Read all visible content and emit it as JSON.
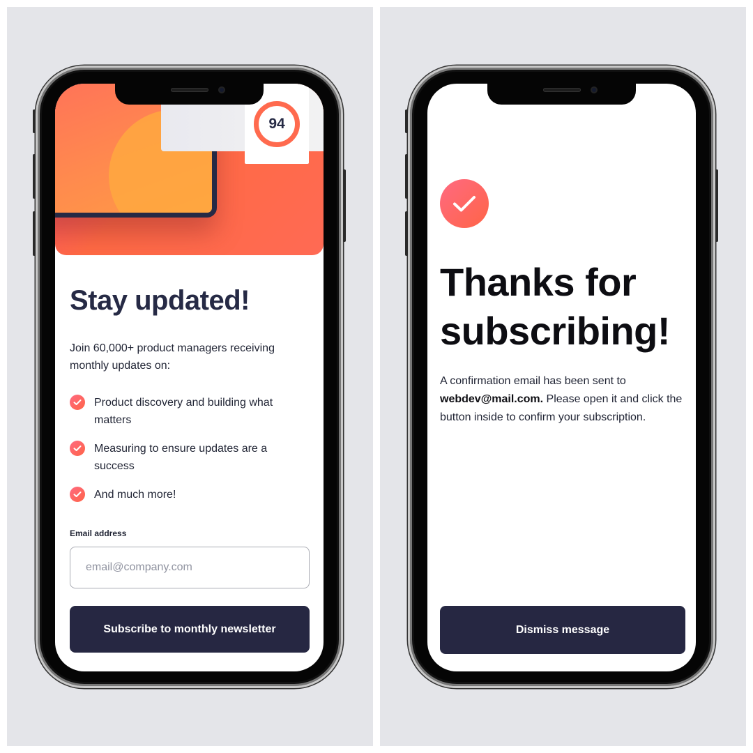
{
  "signup": {
    "score": "94",
    "title": "Stay updated!",
    "intro": "Join 60,000+ product managers receiving monthly updates on:",
    "features": [
      "Product discovery and building what matters",
      "Measuring to ensure updates are a success",
      "And much more!"
    ],
    "email_label": "Email address",
    "email_value": "",
    "email_placeholder": "email@company.com",
    "subscribe_label": "Subscribe to monthly newsletter"
  },
  "success": {
    "title": "Thanks for subscribing!",
    "confirm_prefix": "A confirmation email has been sent to ",
    "email": "webdev@mail.com.",
    "confirm_suffix": " Please open it and click the button inside to confirm your subscription.",
    "dismiss_label": "Dismiss message"
  },
  "icons": {
    "feature": "check-icon",
    "success": "check-circle-icon"
  },
  "colors": {
    "navy": "#262742",
    "accent_start": "#ff6a81",
    "accent_end": "#ff6447",
    "background": "#e4e5e9"
  }
}
